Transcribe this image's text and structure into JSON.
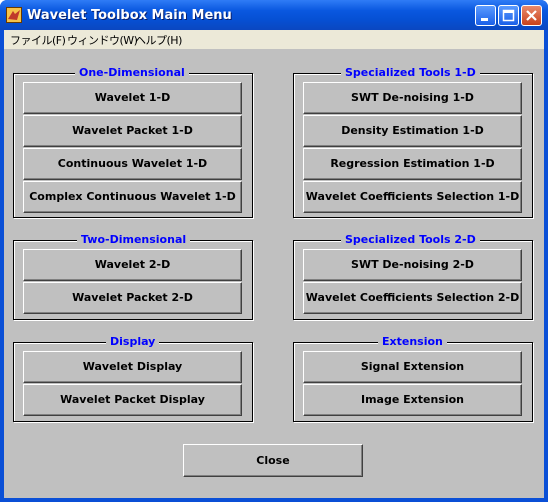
{
  "window": {
    "title": "Wavelet Toolbox Main Menu"
  },
  "menu": [
    "ファイル(F)",
    "ウィンドウ(W)",
    "ヘルプ(H)"
  ],
  "groups": {
    "one_d": {
      "title": "One-Dimensional",
      "buttons": [
        "Wavelet 1-D",
        "Wavelet Packet 1-D",
        "Continuous Wavelet 1-D",
        "Complex Continuous Wavelet 1-D"
      ]
    },
    "spec_1d": {
      "title": "Specialized Tools 1-D",
      "buttons": [
        "SWT De-noising 1-D",
        "Density Estimation 1-D",
        "Regression Estimation 1-D",
        "Wavelet Coefficients Selection 1-D"
      ]
    },
    "two_d": {
      "title": "Two-Dimensional",
      "buttons": [
        "Wavelet 2-D",
        "Wavelet Packet 2-D"
      ]
    },
    "spec_2d": {
      "title": "Specialized Tools 2-D",
      "buttons": [
        "SWT De-noising 2-D",
        "Wavelet Coefficients Selection 2-D"
      ]
    },
    "display": {
      "title": "Display",
      "buttons": [
        "Wavelet Display",
        "Wavelet Packet Display"
      ]
    },
    "extension": {
      "title": "Extension",
      "buttons": [
        "Signal Extension",
        "Image Extension"
      ]
    }
  },
  "close_label": "Close",
  "colors": {
    "titlebar": "#0a58e0",
    "group_title": "#0000ff",
    "background": "#c0c0c0"
  }
}
